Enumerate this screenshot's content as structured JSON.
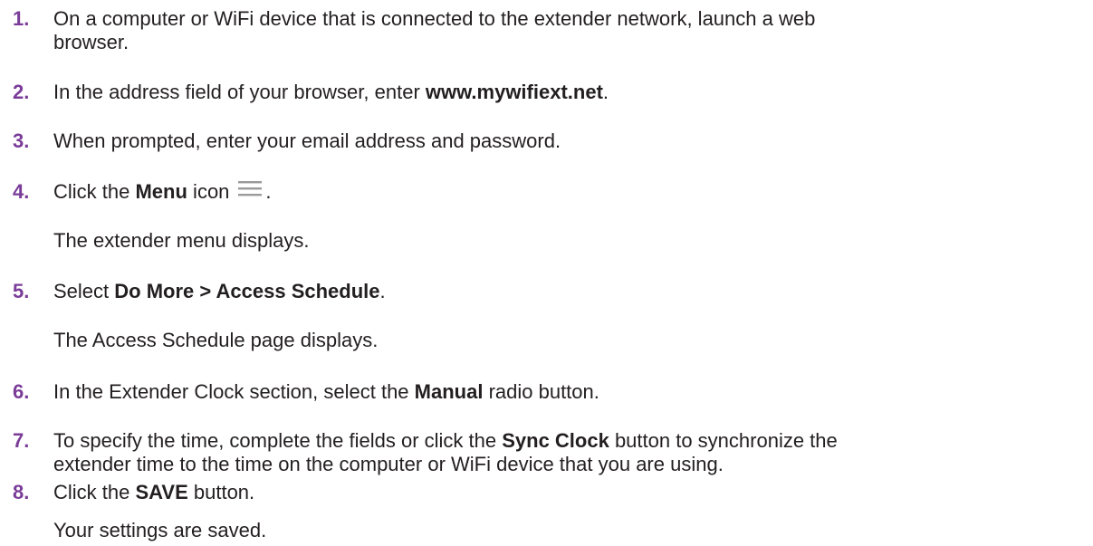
{
  "steps": [
    {
      "number": "1.",
      "line1": "On a computer or WiFi device that is connected to the extender network, launch a web",
      "line2": "browser."
    },
    {
      "number": "2.",
      "pre": "In the address field of your browser, enter ",
      "bold": "www.mywifiext.net",
      "post": "."
    },
    {
      "number": "3.",
      "text": "When prompted, enter your email address and password."
    },
    {
      "number": "4.",
      "pre": "Click the ",
      "bold": "Menu",
      "mid": " icon",
      "post": ".",
      "icon": "hamburger-menu-icon",
      "result": "The extender menu displays."
    },
    {
      "number": "5.",
      "pre": "Select ",
      "bold": "Do More > Access Schedule",
      "post": ".",
      "result": "The Access Schedule page displays."
    },
    {
      "number": "6.",
      "pre": "In the Extender Clock section, select the ",
      "bold": "Manual",
      "post": " radio button."
    },
    {
      "number": "7.",
      "pre": "To specify the time, complete the fields or click the ",
      "bold": "Sync Clock",
      "post": " button to synchronize the",
      "line2": "extender time to the time on the computer or WiFi device that you are using."
    },
    {
      "number": "8.",
      "pre": "Click the ",
      "bold": "SAVE",
      "post": " button.",
      "result": "Your settings are saved."
    }
  ],
  "colors": {
    "number": "#7a3c98",
    "text": "#231f20",
    "icon": "#9a9a9a"
  }
}
